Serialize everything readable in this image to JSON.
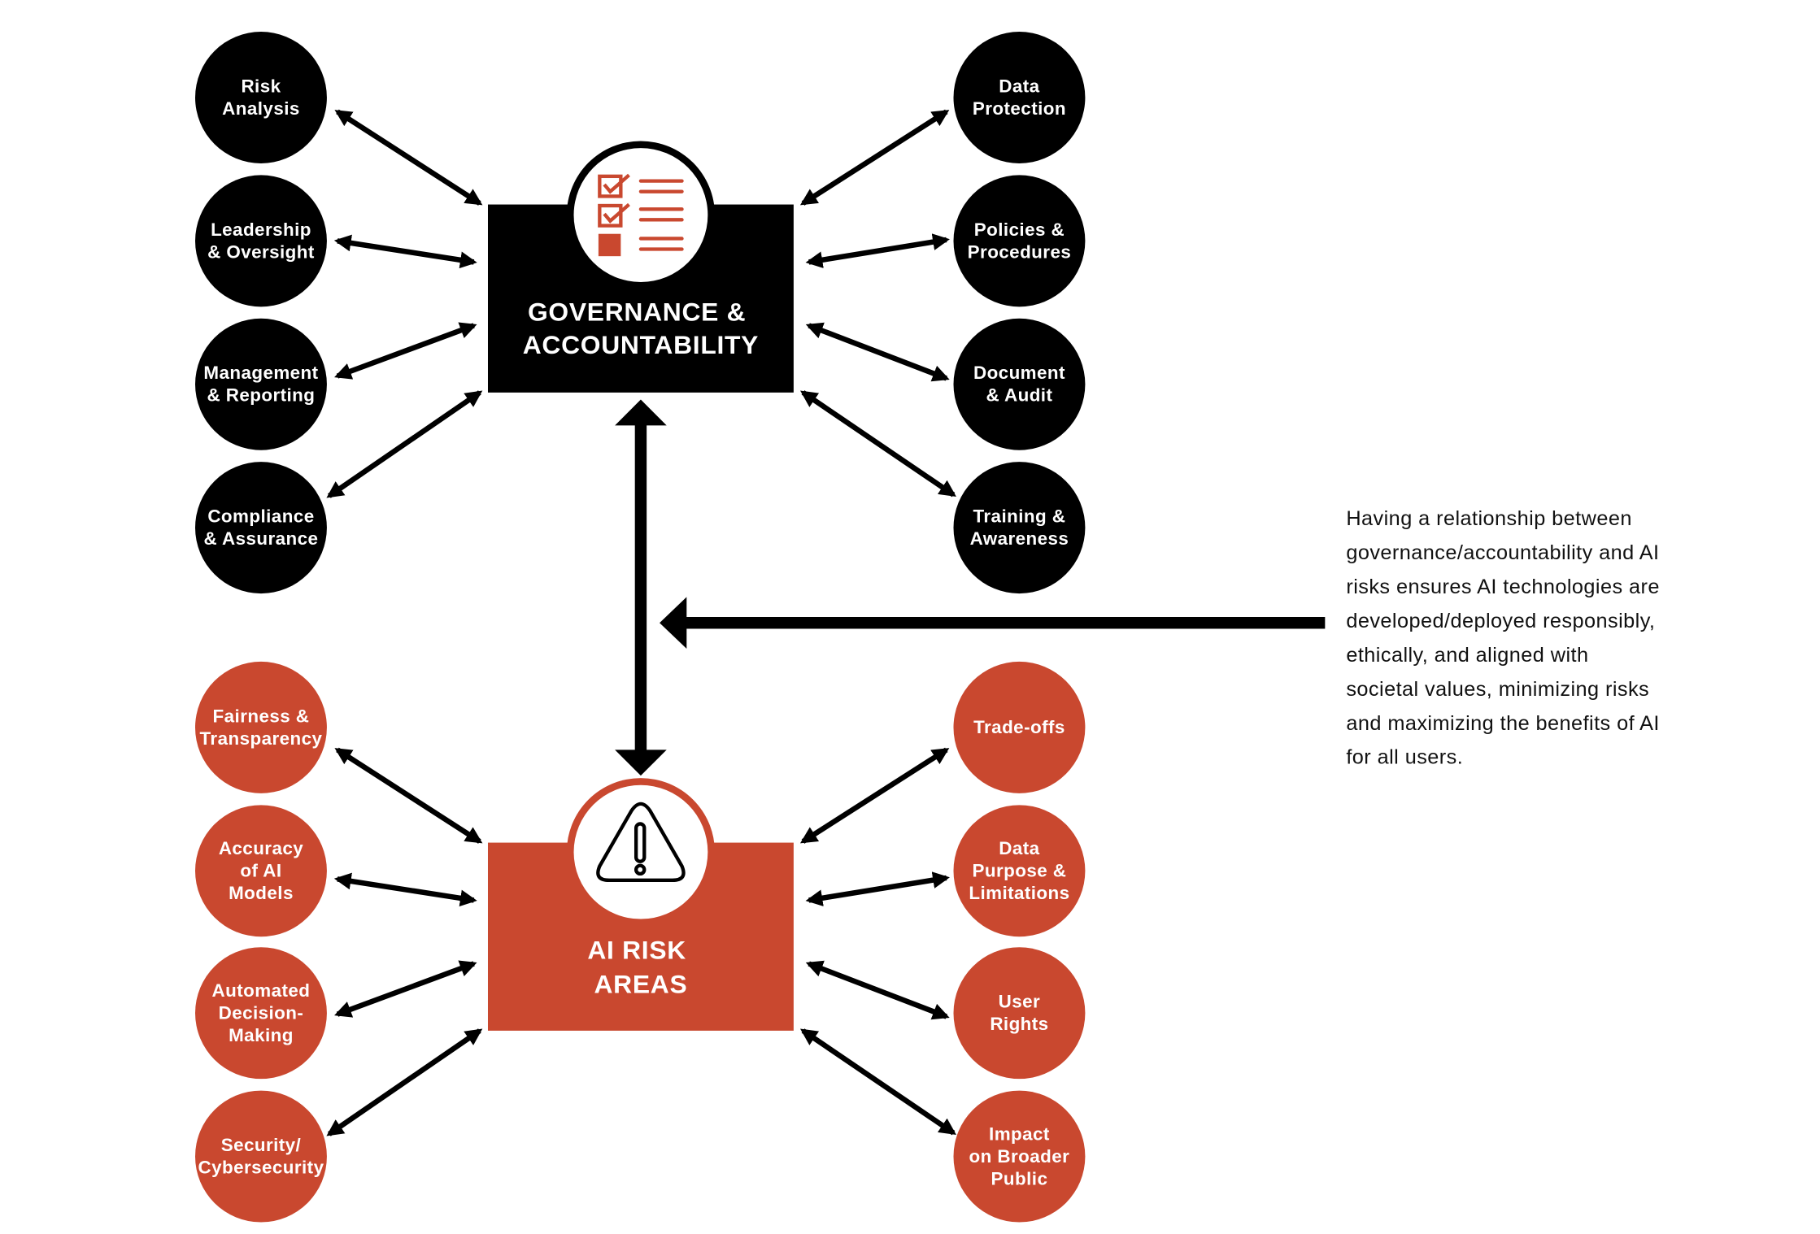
{
  "colors": {
    "governance": "#000000",
    "risk": "#c9482f",
    "arrow": "#000000"
  },
  "governance": {
    "title_lines": [
      "GOVERNANCE &",
      "ACCOUNTABILITY"
    ],
    "icon": "checklist-icon",
    "left_items": [
      [
        "Risk",
        "Analysis"
      ],
      [
        "Leadership",
        "& Oversight"
      ],
      [
        "Management",
        "& Reporting"
      ],
      [
        "Compliance",
        "& Assurance"
      ]
    ],
    "right_items": [
      [
        "Data",
        "Protection"
      ],
      [
        "Policies &",
        "Procedures"
      ],
      [
        "Document",
        "& Audit"
      ],
      [
        "Training &",
        "Awareness"
      ]
    ]
  },
  "risk": {
    "title_lines": [
      "AI RISK",
      "AREAS"
    ],
    "icon": "warning-triangle-icon",
    "left_items": [
      [
        "Fairness &",
        "Transparency"
      ],
      [
        "Accuracy",
        "of AI",
        "Models"
      ],
      [
        "Automated",
        "Decision-",
        "Making"
      ],
      [
        "Security/",
        "Cybersecurity"
      ]
    ],
    "right_items": [
      [
        "Trade-offs"
      ],
      [
        "Data",
        "Purpose &",
        "Limitations"
      ],
      [
        "User",
        "Rights"
      ],
      [
        "Impact",
        "on Broader",
        "Public"
      ]
    ]
  },
  "note": {
    "lines": [
      "Having a relationship between",
      "governance/accountability and AI",
      "risks ensures AI technologies are",
      "developed/deployed responsibly,",
      "ethically, and aligned with",
      "societal values, minimizing risks",
      "and maximizing the benefits of AI",
      "for all users."
    ]
  }
}
